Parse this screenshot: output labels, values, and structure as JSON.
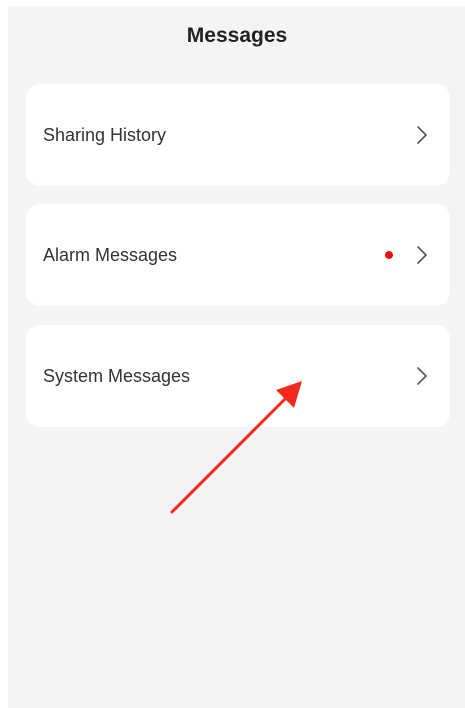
{
  "header": {
    "title": "Messages"
  },
  "menu": {
    "items": [
      {
        "label": "Sharing History",
        "icon": "chevron-right-icon",
        "unread": false
      },
      {
        "label": "Alarm Messages",
        "icon": "chevron-right-icon",
        "unread": true
      },
      {
        "label": "System Messages",
        "icon": "chevron-right-icon",
        "unread": false
      }
    ]
  },
  "colors": {
    "background": "#f4f4f4",
    "card": "#ffffff",
    "unread_dot": "#e8130f",
    "annotation_arrow": "#f52a1e"
  }
}
